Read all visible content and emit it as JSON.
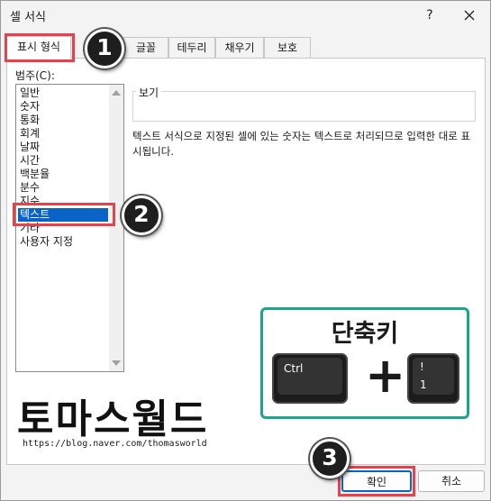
{
  "window": {
    "title": "셀 서식",
    "help_label": "?"
  },
  "tabs": [
    {
      "label": "표시 형식"
    },
    {
      "label": "글꼴"
    },
    {
      "label": "테두리"
    },
    {
      "label": "채우기"
    },
    {
      "label": "보호"
    }
  ],
  "category": {
    "label": "범주(C):",
    "items": [
      "일반",
      "숫자",
      "통화",
      "회계",
      "날짜",
      "시간",
      "백분율",
      "분수",
      "지수",
      "텍스트",
      "기타",
      "사용자 지정"
    ],
    "selected": "텍스트"
  },
  "sample": {
    "label": "보기",
    "description": "텍스트 서식으로 지정된 셀에 있는 숫자는 텍스트로 처리되므로 입력한 대로 표시됩니다."
  },
  "shortcut": {
    "title": "단축키",
    "key1": "Ctrl",
    "key2_top": "!",
    "key2_bottom": "1",
    "plus": "+",
    "accent_color": "#1aa58c"
  },
  "branding": {
    "name": "토마스월드",
    "url": "https://blog.naver.com/thomasworld"
  },
  "buttons": {
    "ok": "확인",
    "cancel": "취소"
  },
  "steps": [
    "1",
    "2",
    "3"
  ],
  "colors": {
    "highlight": "#e8414c",
    "selection": "#0a64c8"
  }
}
